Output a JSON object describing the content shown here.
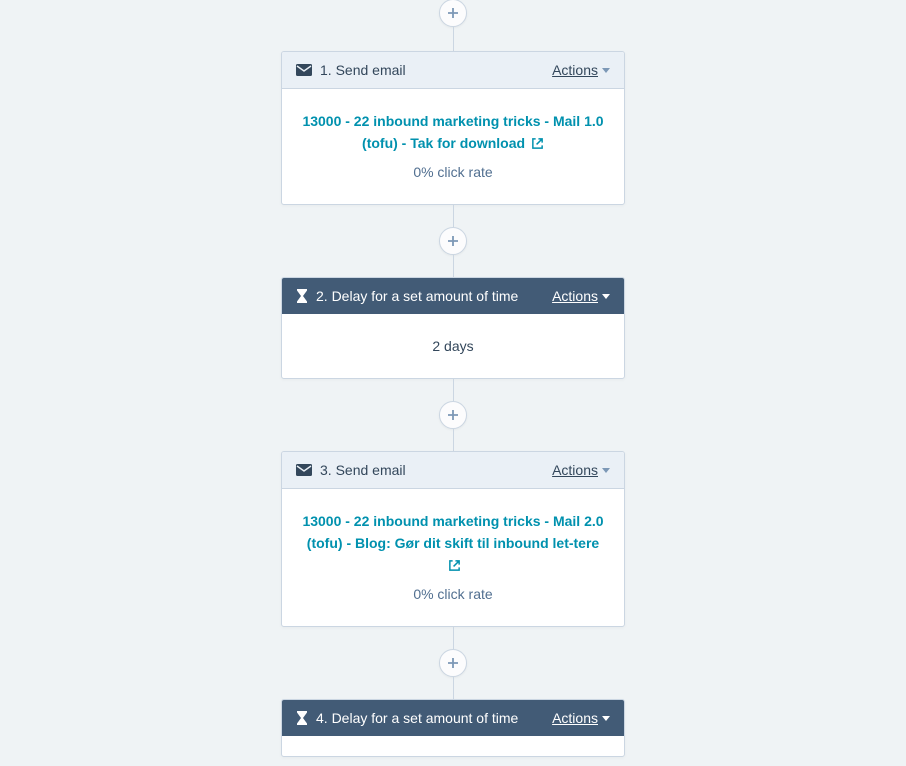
{
  "actions_label": "Actions",
  "steps": [
    {
      "type": "email",
      "header_label": "1. Send email",
      "email_name": "13000 - 22 inbound marketing tricks - Mail 1.0 (tofu) - Tak for download",
      "click_rate": "0% click rate"
    },
    {
      "type": "delay",
      "header_label": "2. Delay for a set amount of time",
      "delay_text": "2 days"
    },
    {
      "type": "email",
      "header_label": "3. Send email",
      "email_name": "13000 - 22 inbound marketing tricks - Mail 2.0 (tofu) - Blog: Gør dit skift til inbound let-tere",
      "click_rate": "0% click rate"
    },
    {
      "type": "delay",
      "header_label": "4. Delay for a set amount of time",
      "delay_text": ""
    }
  ]
}
